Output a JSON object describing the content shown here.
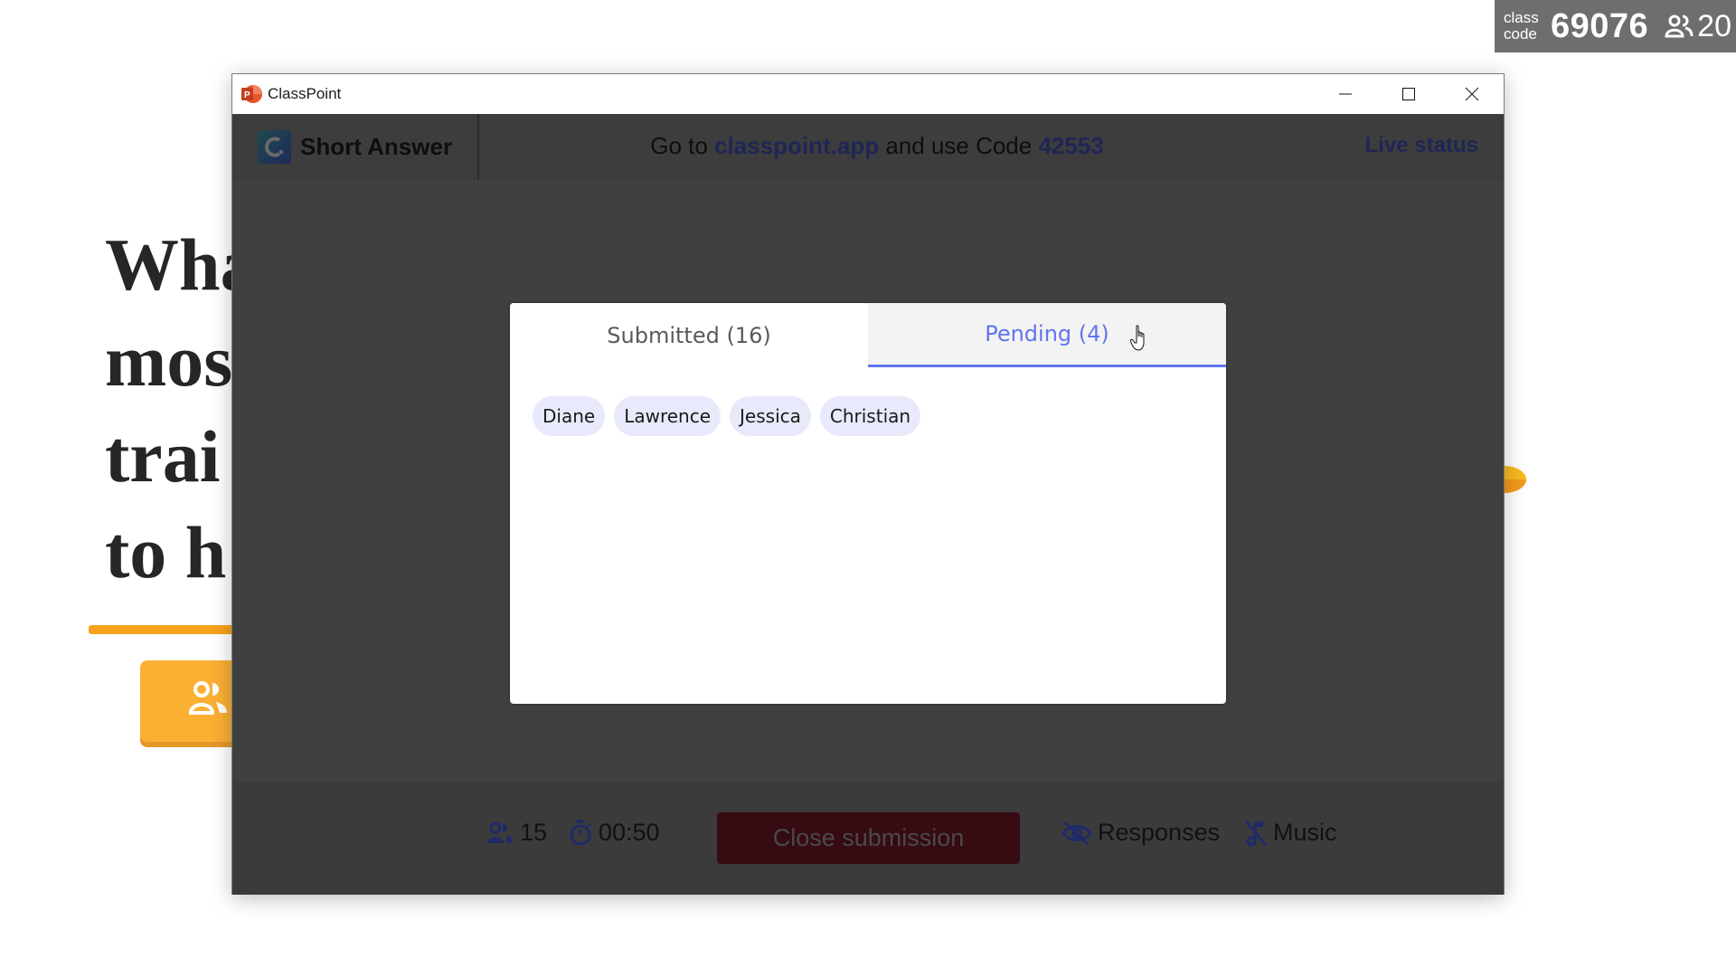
{
  "slide": {
    "title_lines": "Wha\nmos\ntrai\nto h"
  },
  "class_badge": {
    "label_line1": "class",
    "label_line2": "code",
    "code": "69076",
    "participants": "20",
    "icon": "people-icon"
  },
  "window": {
    "title": "ClassPoint",
    "app_icon": "powerpoint-icon",
    "controls": [
      "minimize",
      "maximize",
      "close"
    ]
  },
  "header": {
    "activity": "Short Answer",
    "instructions_prefix": "Go to ",
    "site": "classpoint.app",
    "instructions_middle": " and use Code ",
    "code": "42553",
    "live_status": "Live status"
  },
  "modal": {
    "tabs": [
      {
        "label": "Submitted (16)",
        "active": false
      },
      {
        "label": "Pending (4)",
        "active": true
      }
    ],
    "pending_names": [
      "Diane",
      "Lawrence",
      "Jessica",
      "Christian"
    ]
  },
  "footer": {
    "participants": "15",
    "timer": "00:50",
    "close_label": "Close submission",
    "responses_label": "Responses",
    "music_label": "Music"
  },
  "colors": {
    "accent": "#6274f0",
    "chip_bg": "#e8eafb",
    "slide_orange": "#fbb034",
    "header_link": "#1f2655",
    "close_button": "#360b12"
  }
}
